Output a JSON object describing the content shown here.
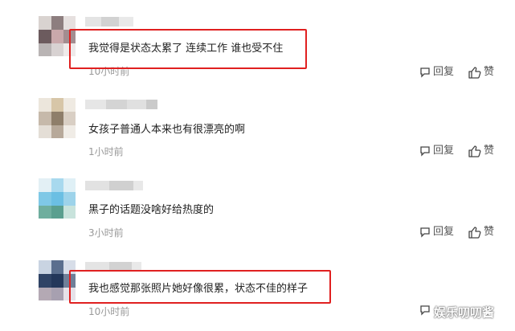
{
  "comments": [
    {
      "text": "我觉得是状态太累了 连续工作 谁也受不住",
      "time": "10小时前",
      "reply_label": "回复",
      "like_label": "赞",
      "highlighted": true
    },
    {
      "text": "女孩子普通人本来也有很漂亮的啊",
      "time": "1小时前",
      "reply_label": "回复",
      "like_label": "赞",
      "highlighted": false
    },
    {
      "text": "黑子的话题没啥好给热度的",
      "time": "3小时前",
      "reply_label": "回复",
      "like_label": "赞",
      "highlighted": false
    },
    {
      "text": "我也感觉那张照片她好像很累，状态不佳的样子",
      "time": "10小时前",
      "reply_label": "回复",
      "like_label": "赞",
      "highlighted": true
    }
  ],
  "watermark": "娱乐叨叨酱",
  "colors": {
    "highlight": "#e02020",
    "time": "#999999",
    "text": "#222222"
  },
  "icons": {
    "reply": "comment-bubble-icon",
    "like": "thumbs-up-icon"
  }
}
